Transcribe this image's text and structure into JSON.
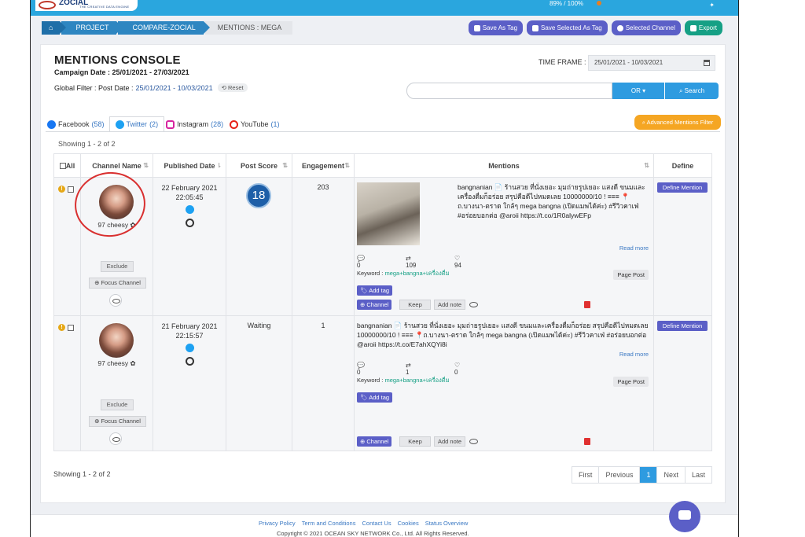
{
  "header": {
    "brand": "ZOCIAL",
    "tagline": "THE CREATIVE DATA ENGINE",
    "stat": "89% / 100%"
  },
  "breadcrumb": [
    "PROJECT",
    "COMPARE-ZOCIAL",
    "MENTIONS : MEGA"
  ],
  "actions": {
    "save_as_tag": "Save As Tag",
    "save_selected": "Save Selected As Tag",
    "selected_channel": "Selected Channel",
    "export": "Export"
  },
  "console": {
    "title": "MENTIONS CONSOLE",
    "campaign_date": "Campaign Date : 25/01/2021 - 27/03/2021",
    "global_filter_label": "Global Filter : Post Date :",
    "global_filter_value": "25/01/2021 - 10/03/2021",
    "reset": "Reset",
    "time_frame_label": "TIME FRAME :",
    "time_frame_value": "25/01/2021 - 10/03/2021",
    "search_placeholder": "",
    "or_label": "OR ▾",
    "search_label": "Search",
    "advanced_filter": "Advanced Mentions Filter"
  },
  "tabs": [
    {
      "name": "Facebook",
      "count": "(58)"
    },
    {
      "name": "Twitter",
      "count": "(2)"
    },
    {
      "name": "Instagram",
      "count": "(28)"
    },
    {
      "name": "YouTube",
      "count": "(1)"
    }
  ],
  "showing": "Showing 1 - 2 of 2",
  "table": {
    "headers": {
      "all": "All",
      "channel": "Channel Name",
      "published": "Published Date",
      "score": "Post Score",
      "engagement": "Engagement",
      "mentions": "Mentions",
      "define": "Define"
    },
    "rows": [
      {
        "channel": "97 cheesy ✿",
        "date": "22 February 2021",
        "time": "22:05:45",
        "score": "18",
        "engagement": "203",
        "mention": "bangnanian 📄 ร้านสวย ที่นั่งเยอะ มุมถ่ายรูปเยอะ แสงดี ขนมและเครื่องดื่มก็อร่อย สรุปคือดีไปหมดเลย 10000000/10 ! ≡≡≡ 📍ถ.บางนา-ตราด ใกล้ๆ mega bangna (เปิดแมพได้ค่ะ) #รีวิวคาเฟ่ #อร่อยบอกต่อ @aroii https://t.co/1R0alywEFp",
        "comments": "0",
        "retweets": "109",
        "likes": "94",
        "keyword": "mega+bangna+เครื่องดื่ม",
        "post_type": "Page Post"
      },
      {
        "channel": "97 cheesy ✿",
        "date": "21 February 2021",
        "time": "22:15:57",
        "score": "Waiting",
        "engagement": "1",
        "mention": "bangnanian 📄 ร้านสวย ที่นั่งเยอะ มุมถ่ายรูปเยอะ แสงดี ขนมและเครื่องดื่มก็อร่อย สรุปคือดีไปหมดเลย 10000000/10 ! ≡≡≡ 📍ถ.บางนา-ตราด ใกล้ๆ mega bangna (เปิดแมพได้ค่ะ) #รีวิวคาเฟ่ #อร่อยบอกต่อ @aroii https://t.co/E7ahXQYi8i",
        "comments": "0",
        "retweets": "1",
        "likes": "0",
        "keyword": "mega+bangna+เครื่องดื่ม",
        "post_type": "Page Post"
      }
    ],
    "labels": {
      "exclude": "Exclude",
      "focus": "Focus Channel",
      "read_more": "Read more",
      "keyword": "Keyword :",
      "add_tag": "Add tag",
      "channel_btn": "Channel",
      "keep": "Keep",
      "add_note": "Add note",
      "define_btn": "Define Mention"
    }
  },
  "pager": [
    "First",
    "Previous",
    "1",
    "Next",
    "Last"
  ],
  "footer": {
    "links": [
      "Privacy Policy",
      "Term and Conditions",
      "Contact Us",
      "Cookies",
      "Status Overview"
    ],
    "copyright": "Copyright © 2021 OCEAN SKY NETWORK Co., Ltd. All Rights Reserved."
  },
  "colors": {
    "accent": "#2e9be0",
    "topbar": "#2aa6de",
    "purple": "#5b5fc7",
    "orange": "#f5a623",
    "highlight_ring": "#d93030"
  }
}
